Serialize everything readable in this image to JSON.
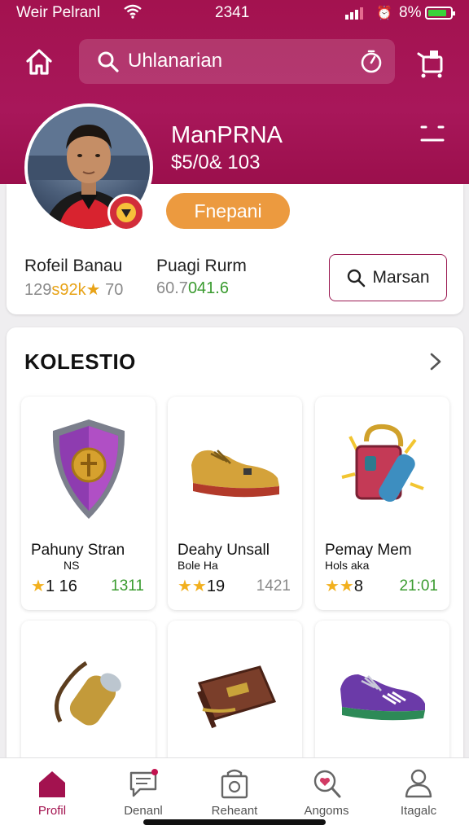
{
  "status_bar": {
    "carrier": "Weir Pelranl",
    "time": "2341",
    "battery_pct": "8%",
    "battery_level": 0.85
  },
  "search": {
    "value": "Uhlanarian"
  },
  "profile": {
    "name": "ManPRNA",
    "balance": "$5/0& 103",
    "pill_label": "Fnepani"
  },
  "stats": [
    {
      "label": "Rofeil Banau",
      "parts": [
        "129",
        "s92k★",
        " 70"
      ]
    },
    {
      "label": "Puagi Rurm",
      "parts": [
        "60.7",
        "041.6"
      ]
    }
  ],
  "action_button": {
    "label": "Marsan"
  },
  "collection": {
    "title": "KOLESTIO",
    "items": [
      {
        "name": "Pahuny Stran",
        "sub": "NS",
        "rating": "1 16",
        "value": "1311",
        "value_color": "#3a9b2f",
        "icon": "shield-icon"
      },
      {
        "name": "Deahy Unsall",
        "sub": "Bole Ha",
        "rating": "19",
        "value": "1421",
        "value_color": "#8a8a8a",
        "icon": "sneaker-icon"
      },
      {
        "name": "Pemay Mem",
        "sub": "Hols aka",
        "rating": "8",
        "value": "21:01",
        "value_color": "#3a9b2f",
        "icon": "bag-icon"
      },
      {
        "icon": "scroll-icon"
      },
      {
        "icon": "wallet-icon"
      },
      {
        "icon": "running-shoe-icon"
      }
    ]
  },
  "nav": [
    {
      "label": "Profil",
      "icon": "home-icon"
    },
    {
      "label": "Denanl",
      "icon": "chat-icon"
    },
    {
      "label": "Reheant",
      "icon": "store-icon"
    },
    {
      "label": "Angoms",
      "icon": "heart-search-icon"
    },
    {
      "label": "Itagalc",
      "icon": "user-icon"
    }
  ],
  "colors": {
    "brand": "#a3124f",
    "pill": "#ec9a3f",
    "star": "#f2b01e",
    "positive": "#3a9b2f"
  }
}
